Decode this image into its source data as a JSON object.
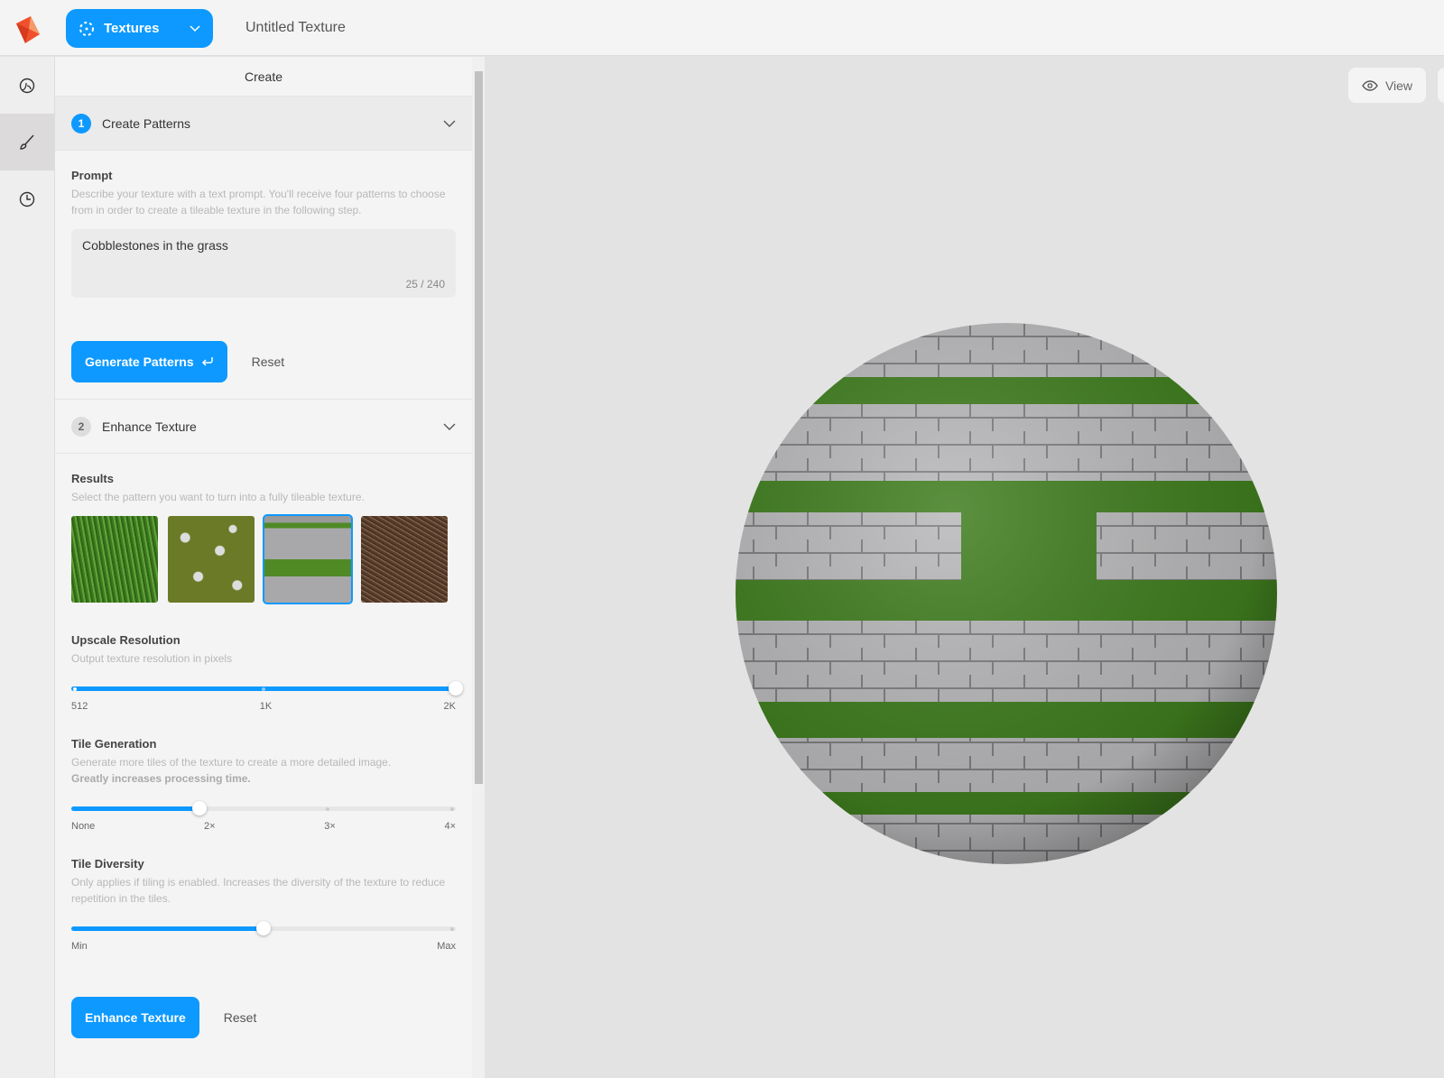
{
  "header": {
    "mode_label": "Textures",
    "document_title": "Untitled Texture"
  },
  "rail": {
    "items": [
      {
        "icon": "palette-icon"
      },
      {
        "icon": "brush-icon",
        "active": true
      },
      {
        "icon": "history-icon"
      }
    ]
  },
  "panel": {
    "title": "Create",
    "step1": {
      "number": "1",
      "label": "Create Patterns",
      "prompt_label": "Prompt",
      "prompt_desc": "Describe your texture with a text prompt. You'll receive four patterns to choose from in order to create a tileable texture in the following step.",
      "prompt_value": "Cobblestones in the grass",
      "char_count": "25 / 240",
      "generate_label": "Generate Patterns",
      "reset_label": "Reset"
    },
    "step2": {
      "number": "2",
      "label": "Enhance Texture",
      "results_label": "Results",
      "results_desc": "Select the pattern you want to turn into a fully tileable texture.",
      "results": [
        {
          "name": "grass"
        },
        {
          "name": "pebbles-on-grass"
        },
        {
          "name": "cobblestones-in-grass",
          "selected": true
        },
        {
          "name": "dry-needles"
        }
      ],
      "upscale": {
        "label": "Upscale Resolution",
        "desc": "Output texture resolution in pixels",
        "ticks": [
          "512",
          "1K",
          "2K"
        ],
        "value": "2K",
        "fraction": 1.0
      },
      "tile_gen": {
        "label": "Tile Generation",
        "desc": "Generate more tiles of the texture to create a more detailed image.",
        "desc_bold": "Greatly increases processing time.",
        "ticks": [
          "None",
          "2×",
          "3×",
          "4×"
        ],
        "value": "2×",
        "fraction": 0.3333
      },
      "tile_div": {
        "label": "Tile Diversity",
        "desc": "Only applies if tiling is enabled. Increases the diversity of the texture to reduce repetition in the tiles.",
        "ticks": [
          "Min",
          "Max"
        ],
        "fraction": 0.5
      },
      "enhance_label": "Enhance Texture",
      "reset_label": "Reset"
    }
  },
  "viewport": {
    "view_label": "View"
  },
  "colors": {
    "accent": "#0d99ff",
    "stone": "#b9b9bb",
    "grass": "#3f7d1e"
  }
}
